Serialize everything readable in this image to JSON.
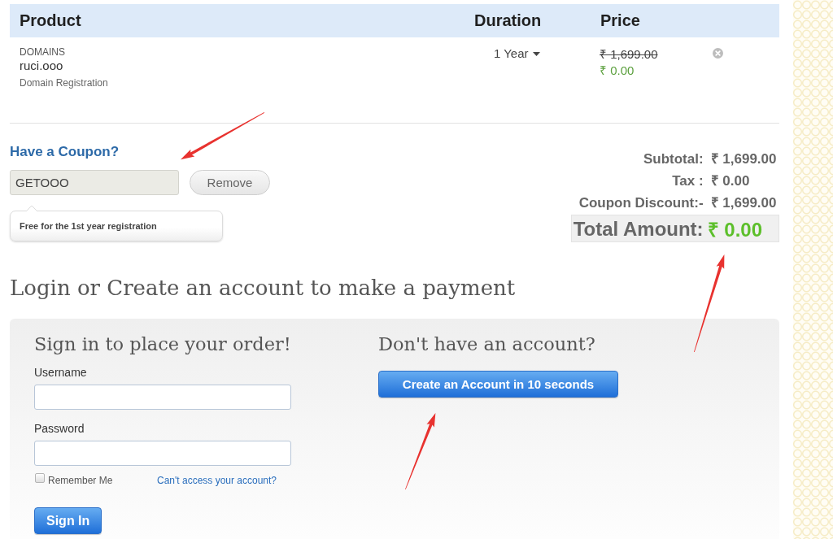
{
  "cart": {
    "columns": [
      "Product",
      "Duration",
      "Price"
    ],
    "items": [
      {
        "category": "DOMAINS",
        "name": "ruci.ooo",
        "description": "Domain Registration",
        "duration": "1 Year",
        "original_price": "₹ 1,699.00",
        "price": "₹ 0.00"
      }
    ]
  },
  "coupon": {
    "heading": "Have a Coupon?",
    "value": "GETOOO",
    "button": "Remove",
    "note": "Free for the 1st year registration"
  },
  "summary": {
    "rows": [
      {
        "label": "Subtotal:",
        "value": "₹ 1,699.00"
      },
      {
        "label": "Tax :",
        "value": "₹ 0.00"
      },
      {
        "label": "Coupon Discount:-",
        "value": "₹ 1,699.00"
      }
    ],
    "total": {
      "label": "Total Amount:",
      "value": "₹ 0.00"
    }
  },
  "login": {
    "heading": "Login or Create an account to make a payment",
    "sign_in": {
      "heading": "Sign in to place your order!",
      "fields": [
        {
          "label": "Username"
        },
        {
          "label": "Password"
        }
      ],
      "remember": {
        "label": "Remember Me",
        "checked": false
      },
      "forgot_link": "Can't access your account?",
      "button": "Sign In"
    },
    "register": {
      "heading": "Don't have an account?",
      "button": "Create an Account in 10 seconds"
    }
  }
}
